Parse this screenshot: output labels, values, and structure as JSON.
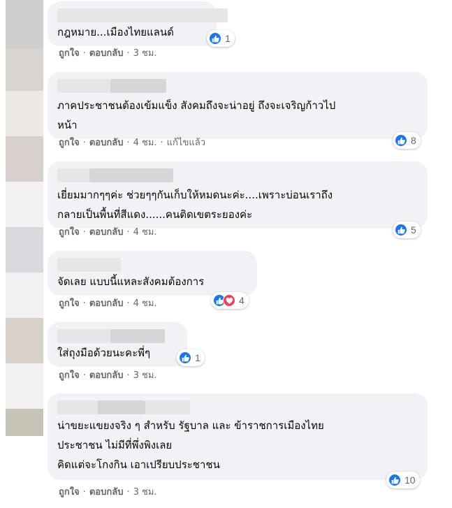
{
  "colors": {
    "bubble_bg": "#f0f2f5",
    "text": "#050505",
    "meta_text": "#65676b",
    "like_blue": "#1877f2",
    "love_red": "#f33e58",
    "redacted_name": "#e6e6e6"
  },
  "avatar_strip_colors": [
    "#cfcfcf",
    "#d8d4d0",
    "#ebe8e6",
    "#d8d0cf",
    "#f2f2f2",
    "#d9d9dd",
    "#f1f1f1",
    "#d8d1ca",
    "#f2f2f2",
    "#c6c3b7"
  ],
  "actions": {
    "like": "ถูกใจ",
    "reply": "ตอบกลับ",
    "separator": "·"
  },
  "comments": [
    {
      "lines": [
        "กฎหมาย...เมืองไทยแลนด์"
      ],
      "reactions": {
        "icons": [
          "like-icon"
        ],
        "count": "1"
      },
      "time": "3 ชม.",
      "edited": ""
    },
    {
      "lines": [
        "ภาคประชาชนต้องเข้มแข็ง สังคมถึงจะน่าอยู่ ถึงจะเจริญก้าวไป",
        "หน้า"
      ],
      "reactions": {
        "icons": [
          "like-icon"
        ],
        "count": "8"
      },
      "time": "4 ชม.",
      "edited": "แก้ไขแล้ว"
    },
    {
      "lines": [
        "เยี่ยมมากๆๆค่ะ ช่วยๆๆกันเก็บให้หมดนะค่ะ....เพราะบ่อนเราถึง",
        "กลายเป็นพื้นที่สีแดง......คนติดเขตระยองค่ะ"
      ],
      "reactions": {
        "icons": [
          "like-icon"
        ],
        "count": "5"
      },
      "time": "4 ชม.",
      "edited": ""
    },
    {
      "lines": [
        "จัดเลย แบบนี้แหละสังคมต้องการ"
      ],
      "reactions": {
        "icons": [
          "like-icon",
          "love-icon"
        ],
        "count": "4"
      },
      "time": "4 ชม.",
      "edited": ""
    },
    {
      "lines": [
        "ใส่ถุงมือด้วยนะคะพี่ๆ"
      ],
      "reactions": {
        "icons": [
          "like-icon"
        ],
        "count": "1"
      },
      "time": "3 ชม.",
      "edited": ""
    },
    {
      "lines": [
        "น่าขยะแขยงจริง ๆ สำหรับ รัฐบาล และ ข้าราชการเมืองไทย",
        "ประชาชน ไม่มีที่พึ่งพิงเลย",
        "คิดแต่จะโกงกิน เอาเปรียบประชาชน"
      ],
      "reactions": {
        "icons": [
          "like-icon"
        ],
        "count": "10"
      },
      "time": "3 ชม.",
      "edited": ""
    }
  ]
}
